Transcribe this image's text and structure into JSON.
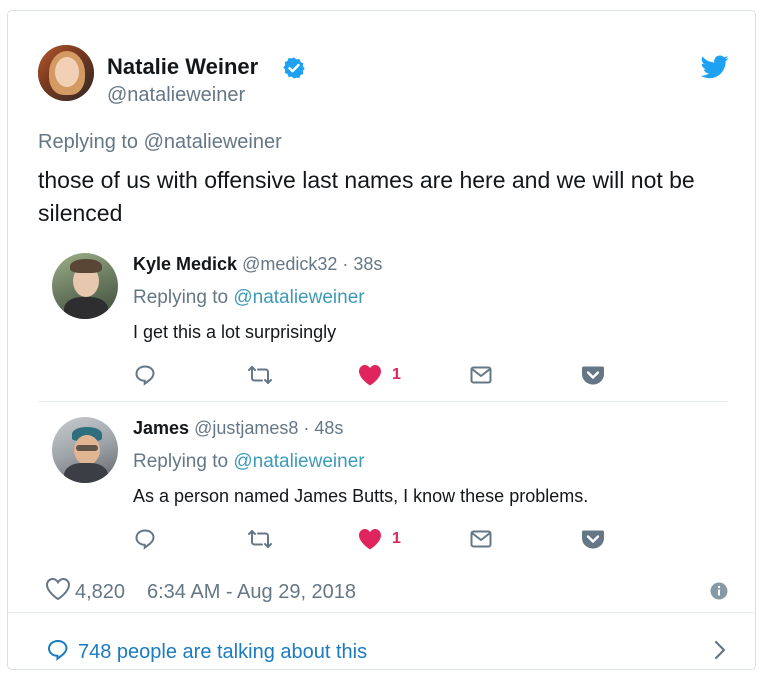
{
  "tweet": {
    "author_name": "Natalie Weiner",
    "author_handle": "@natalieweiner",
    "replying_prefix": "Replying to",
    "replying_mention": "@natalieweiner",
    "text": "those of us with offensive last names are here and we will not be silenced"
  },
  "replies": [
    {
      "name": "Kyle Medick",
      "handle": "@medick32",
      "time": "· 38s",
      "replying_prefix": "Replying to",
      "replying_mention": "@natalieweiner",
      "text": "I get this a lot surprisingly",
      "like_count": "1"
    },
    {
      "name": "James",
      "handle": "@justjames8",
      "time": "· 48s",
      "replying_prefix": "Replying to",
      "replying_mention": "@natalieweiner",
      "text": "As a person named James Butts, I know these problems.",
      "like_count": "1"
    }
  ],
  "footer": {
    "likes": "4,820",
    "timestamp": "6:34 AM - Aug 29, 2018",
    "talking": "748 people are talking about this"
  },
  "colors": {
    "twitter_blue": "#1da1f2",
    "like_red": "#e0245e",
    "muted": "#657786",
    "link": "#1b7bbf"
  }
}
